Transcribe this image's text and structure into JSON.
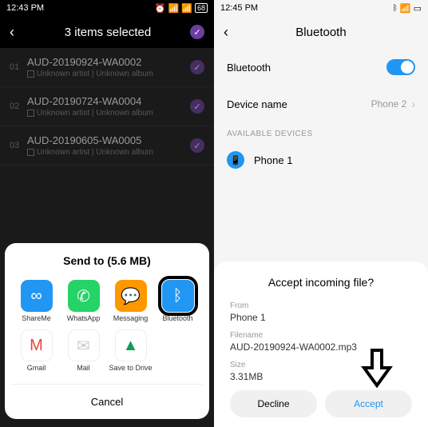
{
  "left": {
    "time": "12:43 PM",
    "battery": "68",
    "header_title": "3 items selected",
    "songs": [
      {
        "num": "01",
        "title": "AUD-20190924-WA0002",
        "sub": "Unknown artist | Unknown album"
      },
      {
        "num": "02",
        "title": "AUD-20190724-WA0004",
        "sub": "Unknown artist | Unknown album"
      },
      {
        "num": "03",
        "title": "AUD-20190605-WA0005",
        "sub": "Unknown artist | Unknown album"
      }
    ],
    "share": {
      "title": "Send to (5.6 MB)",
      "items": [
        {
          "label": "ShareMe",
          "icon": "∞",
          "bg": "#2196f3"
        },
        {
          "label": "WhatsApp",
          "icon": "✆",
          "bg": "#25d366"
        },
        {
          "label": "Messaging",
          "icon": "💬",
          "bg": "#ff9800"
        },
        {
          "label": "Bluetooth",
          "icon": "ᛒ",
          "bg": "#2196f3",
          "highlight": true
        },
        {
          "label": "Gmail",
          "icon": "M",
          "bg": "#fff",
          "fg": "#ea4335"
        },
        {
          "label": "Mail",
          "icon": "✉",
          "bg": "#fff",
          "fg": "#ccc"
        },
        {
          "label": "Save to Drive",
          "icon": "▲",
          "bg": "#fff",
          "fg": "#0f9d58"
        }
      ],
      "cancel": "Cancel"
    }
  },
  "right": {
    "time": "12:45 PM",
    "header_title": "Bluetooth",
    "bluetooth_label": "Bluetooth",
    "device_name_label": "Device name",
    "device_name_value": "Phone 2",
    "available_label": "AVAILABLE DEVICES",
    "device1": "Phone 1",
    "incoming": {
      "title": "Accept incoming file?",
      "from_label": "From",
      "from_value": "Phone 1",
      "filename_label": "Filename",
      "filename_value": "AUD-20190924-WA0002.mp3",
      "size_label": "Size",
      "size_value": "3.31MB",
      "decline": "Decline",
      "accept": "Accept"
    }
  }
}
